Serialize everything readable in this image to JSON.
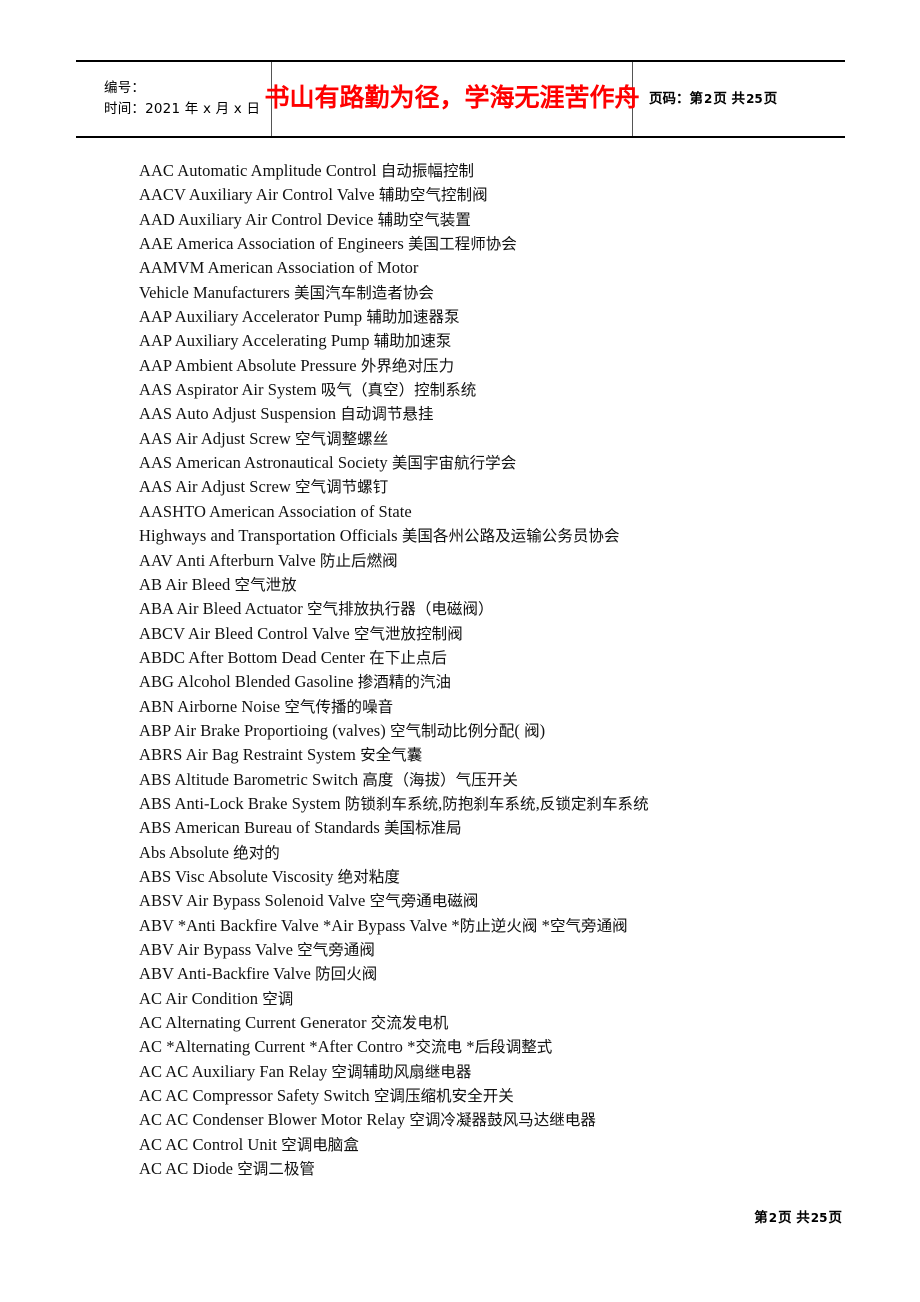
{
  "header": {
    "field_label_id": "编号：",
    "field_label_time": "时间：2021 年 x 月 x 日",
    "motto": "书山有路勤为径，学海无涯苦作舟",
    "page_code_prefix": "页码：第",
    "page_code_current": "2",
    "page_code_mid": "页  共",
    "page_code_total": "25",
    "page_code_suffix": "页",
    "motto_color": "#FF0000"
  },
  "footer": {
    "prefix": "第",
    "current": "2",
    "mid": "页  共",
    "total": "25",
    "suffix": "页"
  },
  "entries": [
    "AAC Automatic Amplitude Control  自动振幅控制",
    "AACV Auxiliary Air Control Valve  辅助空气控制阀",
    "AAD Auxiliary Air Control Device  辅助空气装置",
    "AAE America Association of Engineers  美国工程师协会",
    "AAMVM American Association of Motor",
    "Vehicle Manufacturers  美国汽车制造者协会",
    "AAP Auxiliary Accelerator Pump  辅助加速器泵",
    "AAP Auxiliary Accelerating Pump  辅助加速泵",
    "AAP Ambient Absolute Pressure  外界绝对压力",
    "AAS Aspirator Air System  吸气（真空）控制系统",
    "AAS Auto Adjust Suspension  自动调节悬挂",
    "AAS Air Adjust Screw  空气调整螺丝",
    "AAS American Astronautical Society  美国宇宙航行学会",
    "AAS Air Adjust Screw  空气调节螺钉",
    "AASHTO American Association of State",
    "Highways and Transportation Officials 美国各州公路及运输公务员协会",
    "AAV Anti Afterburn Valve  防止后燃阀",
    "AB Air Bleed  空气泄放",
    "ABA Air Bleed Actuator  空气排放执行器（电磁阀）",
    "ABCV Air Bleed Control Valve  空气泄放控制阀",
    "ABDC After Bottom Dead Center  在下止点后",
    "ABG Alcohol Blended Gasoline  掺酒精的汽油",
    "ABN Airborne Noise  空气传播的噪音",
    "ABP Air Brake Proportioing (valves)  空气制动比例分配(  阀)",
    "ABRS Air Bag Restraint System  安全气囊",
    "ABS Altitude Barometric Switch  高度（海拔）气压开关",
    "ABS Anti-Lock Brake System  防锁刹车系统,防抱刹车系统,反锁定刹车系统",
    "ABS American Bureau of Standards  美国标准局",
    "Abs Absolute  绝对的",
    "ABS Visc Absolute Viscosity  绝对粘度",
    "ABSV Air Bypass Solenoid Valve  空气旁通电磁阀",
    "ABV *Anti Backfire Valve *Air Bypass Valve *防止逆火阀  *空气旁通阀",
    "ABV Air Bypass Valve  空气旁通阀",
    "ABV Anti-Backfire Valve  防回火阀",
    "AC Air Condition  空调",
    "AC Alternating Current Generator  交流发电机",
    "AC *Alternating Current *After Contro *交流电  *后段调整式",
    "AC AC Auxiliary Fan Relay  空调辅助风扇继电器",
    "AC AC Compressor Safety Switch  空调压缩机安全开关",
    "AC AC Condenser Blower Motor Relay  空调冷凝器鼓风马达继电器",
    "AC AC Control Unit  空调电脑盒",
    "AC AC Diode  空调二极管"
  ]
}
